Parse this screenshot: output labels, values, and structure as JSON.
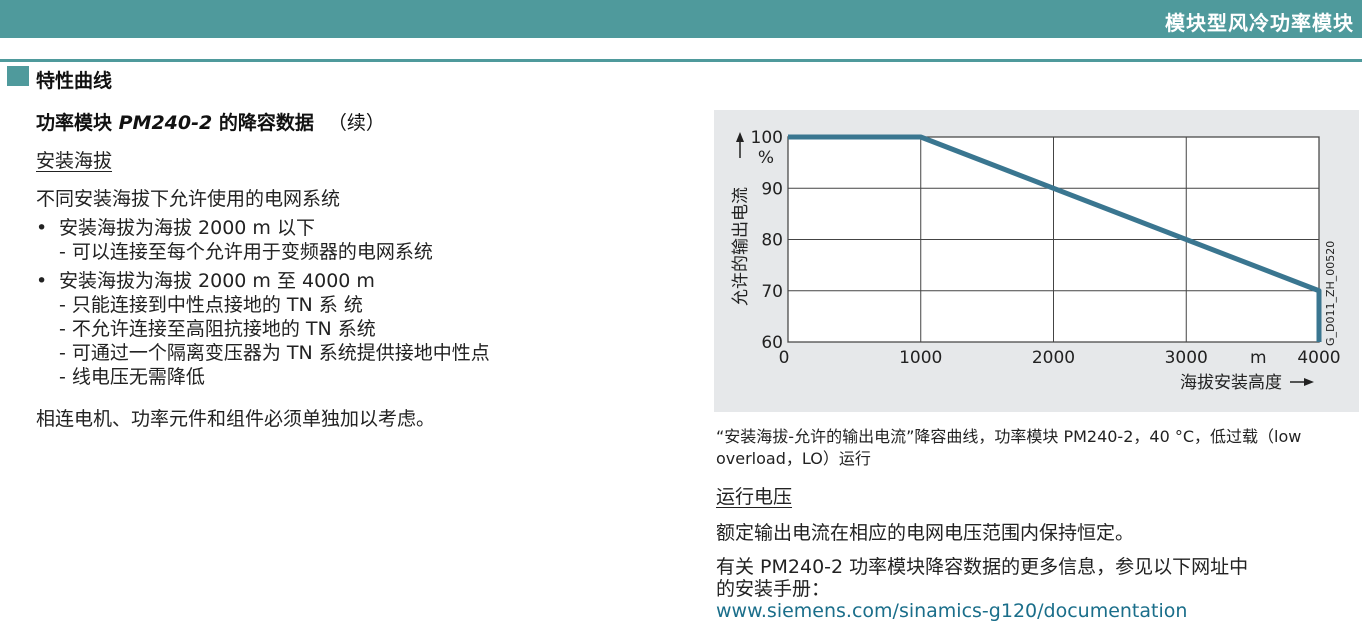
{
  "header": {
    "title": "模块型风冷功率模块"
  },
  "section": {
    "title": "特性曲线"
  },
  "subsection": {
    "prefix": "功率模块 ",
    "model": "PM240-2",
    "suffix": " 的降容数据",
    "continued": "（续）"
  },
  "altitude": {
    "heading": "安装海拔",
    "intro": "不同安装海拔下允许使用的电网系统",
    "bullets": [
      {
        "text": "安装海拔为海拔 2000 m 以下",
        "subitems": [
          "- 可以连接至每个允许用于变频器的电网系统"
        ]
      },
      {
        "text": "安装海拔为海拔 2000 m 至 4000 m",
        "subitems": [
          "- 只能连接到中性点接地的 TN 系 统",
          "- 不允许连接至高阻抗接地的 TN 系统",
          "- 可通过一个隔离变压器为 TN 系统提供接地中性点",
          "- 线电压无需降低"
        ]
      }
    ],
    "note": "相连电机、功率元件和组件必须单独加以考虑。"
  },
  "chart_data": {
    "type": "line",
    "title": "",
    "xlabel": "海拔安装高度",
    "xunit": "m",
    "ylabel": "允许的输出电流",
    "yunit": "%",
    "xlim": [
      0,
      4000
    ],
    "ylim": [
      60,
      100
    ],
    "xticks": [
      0,
      1000,
      2000,
      3000,
      4000
    ],
    "yticks": [
      60,
      70,
      80,
      90,
      100
    ],
    "grid": true,
    "series": [
      {
        "x": [
          0,
          1000,
          4000,
          4000
        ],
        "y": [
          100,
          100,
          70,
          60
        ],
        "color": "#3a7690"
      }
    ],
    "code": "G_D011_ZH_00520"
  },
  "caption": {
    "text": "“安装海拔-允许的输出电流”降容曲线，功率模块 PM240-2，40 °C，低过载（low overload，LO）运行"
  },
  "voltage": {
    "heading": "运行电压",
    "text": "额定输出电流在相应的电网电压范围内保持恒定。",
    "more_line1": "有关 PM240-2 功率模块降容数据的更多信息，参见以下网址中",
    "more_line2": "的安装手册：",
    "url": "www.siemens.com/sinamics-g120/documentation"
  },
  "colors": {
    "accent": "#4f9a9c",
    "curve": "#3a7690",
    "chart_bg": "#e6e8ea",
    "link": "#1a6e8a"
  }
}
